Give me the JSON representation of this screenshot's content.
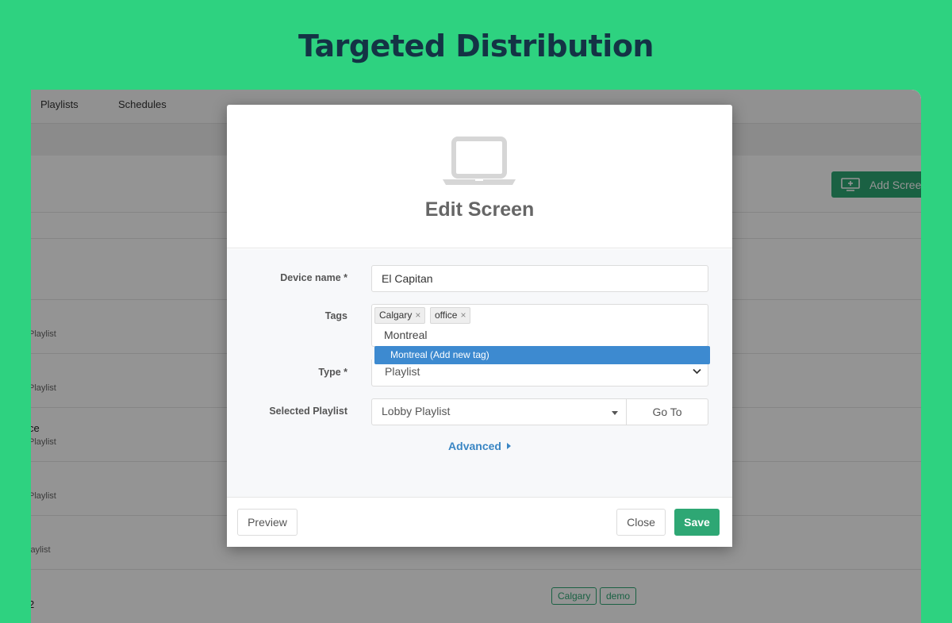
{
  "hero": {
    "title": "Targeted Distribution"
  },
  "background_app": {
    "nav_items": [
      "Playlists",
      "Schedules"
    ],
    "add_screen_label": "Add Scree",
    "rows": [
      {
        "name": "",
        "sub": "Playlist"
      },
      {
        "name": "",
        "sub": "Playlist"
      },
      {
        "name": "ce",
        "sub": "Playlist"
      },
      {
        "name": "",
        "sub": "Playlist"
      },
      {
        "name": "",
        "sub": "laylist"
      },
      {
        "name": "2",
        "sub": ""
      }
    ],
    "last_row_tags": [
      "Calgary",
      "demo"
    ]
  },
  "modal": {
    "title": "Edit Screen",
    "fields": {
      "device_name": {
        "label": "Device name *",
        "value": "El Capitan"
      },
      "tags": {
        "label": "Tags",
        "chips": [
          {
            "text": "Calgary",
            "remove": "×"
          },
          {
            "text": "office",
            "remove": "×"
          }
        ],
        "typed": "Montreal",
        "suggestion": "Montreal (Add new tag)"
      },
      "type": {
        "label": "Type *",
        "value": "Playlist"
      },
      "selected_playlist": {
        "label": "Selected Playlist",
        "value": "Lobby Playlist",
        "goto_label": "Go To"
      }
    },
    "advanced_label": "Advanced",
    "footer": {
      "preview_label": "Preview",
      "close_label": "Close",
      "save_label": "Save"
    }
  },
  "colors": {
    "page_background": "#2ed280",
    "title_text": "#143345",
    "brand_green": "#2ea774",
    "link_blue": "#3a86c4",
    "selection_blue": "#3d8ad0"
  },
  "icons": [
    "laptop-icon",
    "add-screen-icon",
    "chip-remove-icon",
    "chevron-down-icon",
    "caret-down-icon",
    "caret-right-icon"
  ]
}
